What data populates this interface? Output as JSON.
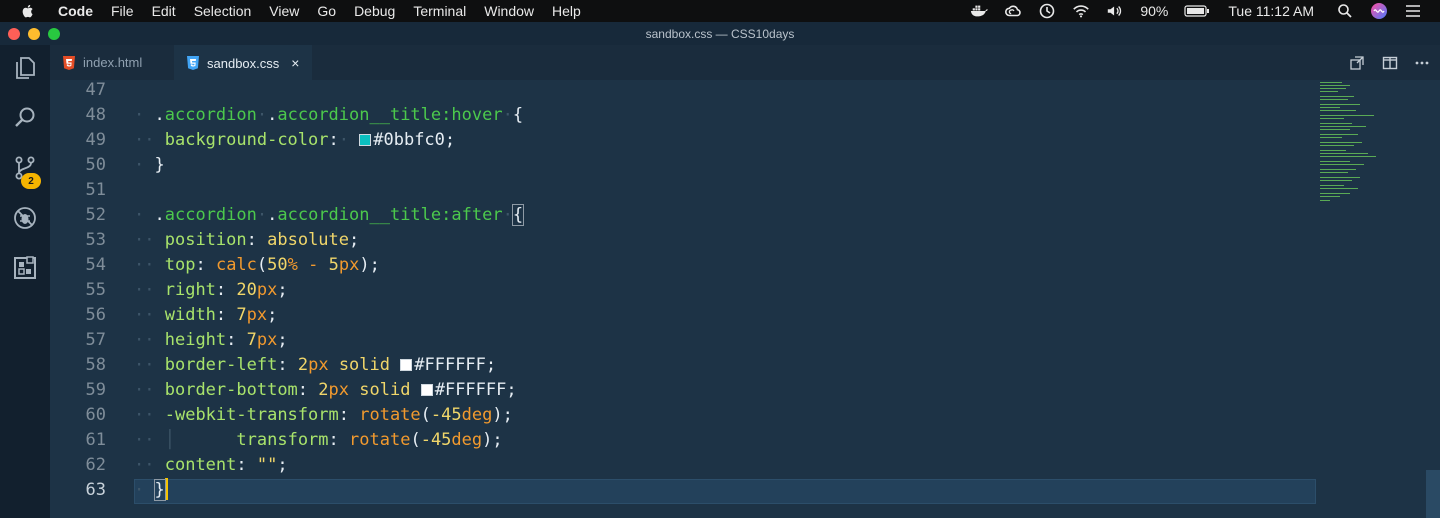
{
  "menubar": {
    "app": "Code",
    "menus": [
      "File",
      "Edit",
      "Selection",
      "View",
      "Go",
      "Debug",
      "Terminal",
      "Window",
      "Help"
    ],
    "battery": "90%",
    "clock": "Tue 11:12 AM"
  },
  "window": {
    "title": "sandbox.css — CSS10days"
  },
  "activity": {
    "scm_badge": "2"
  },
  "tabs": [
    {
      "label": "index.html",
      "icon": "html5-icon",
      "active": false
    },
    {
      "label": "sandbox.css",
      "icon": "css3-icon",
      "active": true,
      "close": "×"
    }
  ],
  "editor": {
    "line_numbers": [
      "47",
      "48",
      "49",
      "50",
      "51",
      "52",
      "53",
      "54",
      "55",
      "56",
      "57",
      "58",
      "59",
      "60",
      "61",
      "62",
      "63"
    ],
    "current_line": "63",
    "tokens": {
      "l48": [
        ".",
        "accordion",
        ".",
        "accordion__title",
        ":hover",
        "{"
      ],
      "l49": [
        "background-color",
        ":",
        "#0bbfc0",
        ";"
      ],
      "l50": [
        "}"
      ],
      "l52": [
        ".",
        "accordion",
        ".",
        "accordion__title",
        ":after",
        "{"
      ],
      "l53": [
        "position",
        ":",
        "absolute",
        ";"
      ],
      "l54": [
        "top",
        ":",
        "calc",
        "(",
        "50",
        "%",
        "-",
        "5",
        "px",
        ");"
      ],
      "l55": [
        "right",
        ":",
        "20",
        "px",
        ";"
      ],
      "l56": [
        "width",
        ":",
        "7",
        "px",
        ";"
      ],
      "l57": [
        "height",
        ":",
        "7",
        "px",
        ";"
      ],
      "l58": [
        "border-left",
        ":",
        "2",
        "px",
        "solid",
        "#FFFFFF",
        ";"
      ],
      "l59": [
        "border-bottom",
        ":",
        "2",
        "px",
        "solid",
        "#FFFFFF",
        ";"
      ],
      "l60": [
        "-webkit-transform",
        ":",
        "rotate",
        "(",
        "-45",
        "deg",
        ");"
      ],
      "l61": [
        "transform",
        ":",
        "rotate",
        "(",
        "-45",
        "deg",
        ");"
      ],
      "l62": [
        "content",
        ":",
        "\"\"",
        ";"
      ],
      "l63": [
        "}"
      ]
    },
    "swatch_colors": {
      "teal": "#0bbfc0",
      "white": "#FFFFFF"
    }
  },
  "colors": {
    "editor_bg": "#1d3346",
    "accent_cursor": "#f5c400",
    "badge": "#f5b400"
  }
}
